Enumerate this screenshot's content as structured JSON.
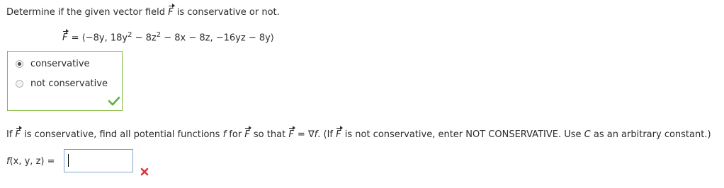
{
  "question": {
    "prefix": "Determine if the given vector field ",
    "vec_symbol": "F",
    "suffix": " is conservative or not."
  },
  "vector_field": {
    "lhs": "F",
    "equals": " = ",
    "open": "⟨",
    "c1": "−8y, 18y",
    "c1_exp": "2",
    "c1_rest": " − 8z",
    "c1_rest_exp": "2",
    "c1_tail": " − 8x − 8z, −16yz − 8y",
    "close": "⟩"
  },
  "choices": {
    "options": [
      {
        "label": "conservative",
        "selected": true
      },
      {
        "label": "not conservative",
        "selected": false
      }
    ],
    "result_icon": "check-mark-icon",
    "result_color": "#59b33a"
  },
  "instruction": {
    "p1": "If ",
    "F": "F",
    "p2": " is conservative, find all potential functions ",
    "f": "f",
    "p3": " for ",
    "p4": " so that ",
    "p5": " = ∇",
    "p6": ". (If ",
    "p7": " is not conservative, enter NOT CONSERVATIVE. Use ",
    "C": "C",
    "p8": " as an arbitrary constant.)"
  },
  "answer": {
    "label_f": "f",
    "label_args": "(x, y, z) =",
    "value": "",
    "result_icon": "x-mark-icon",
    "result_color": "#d9363e"
  }
}
